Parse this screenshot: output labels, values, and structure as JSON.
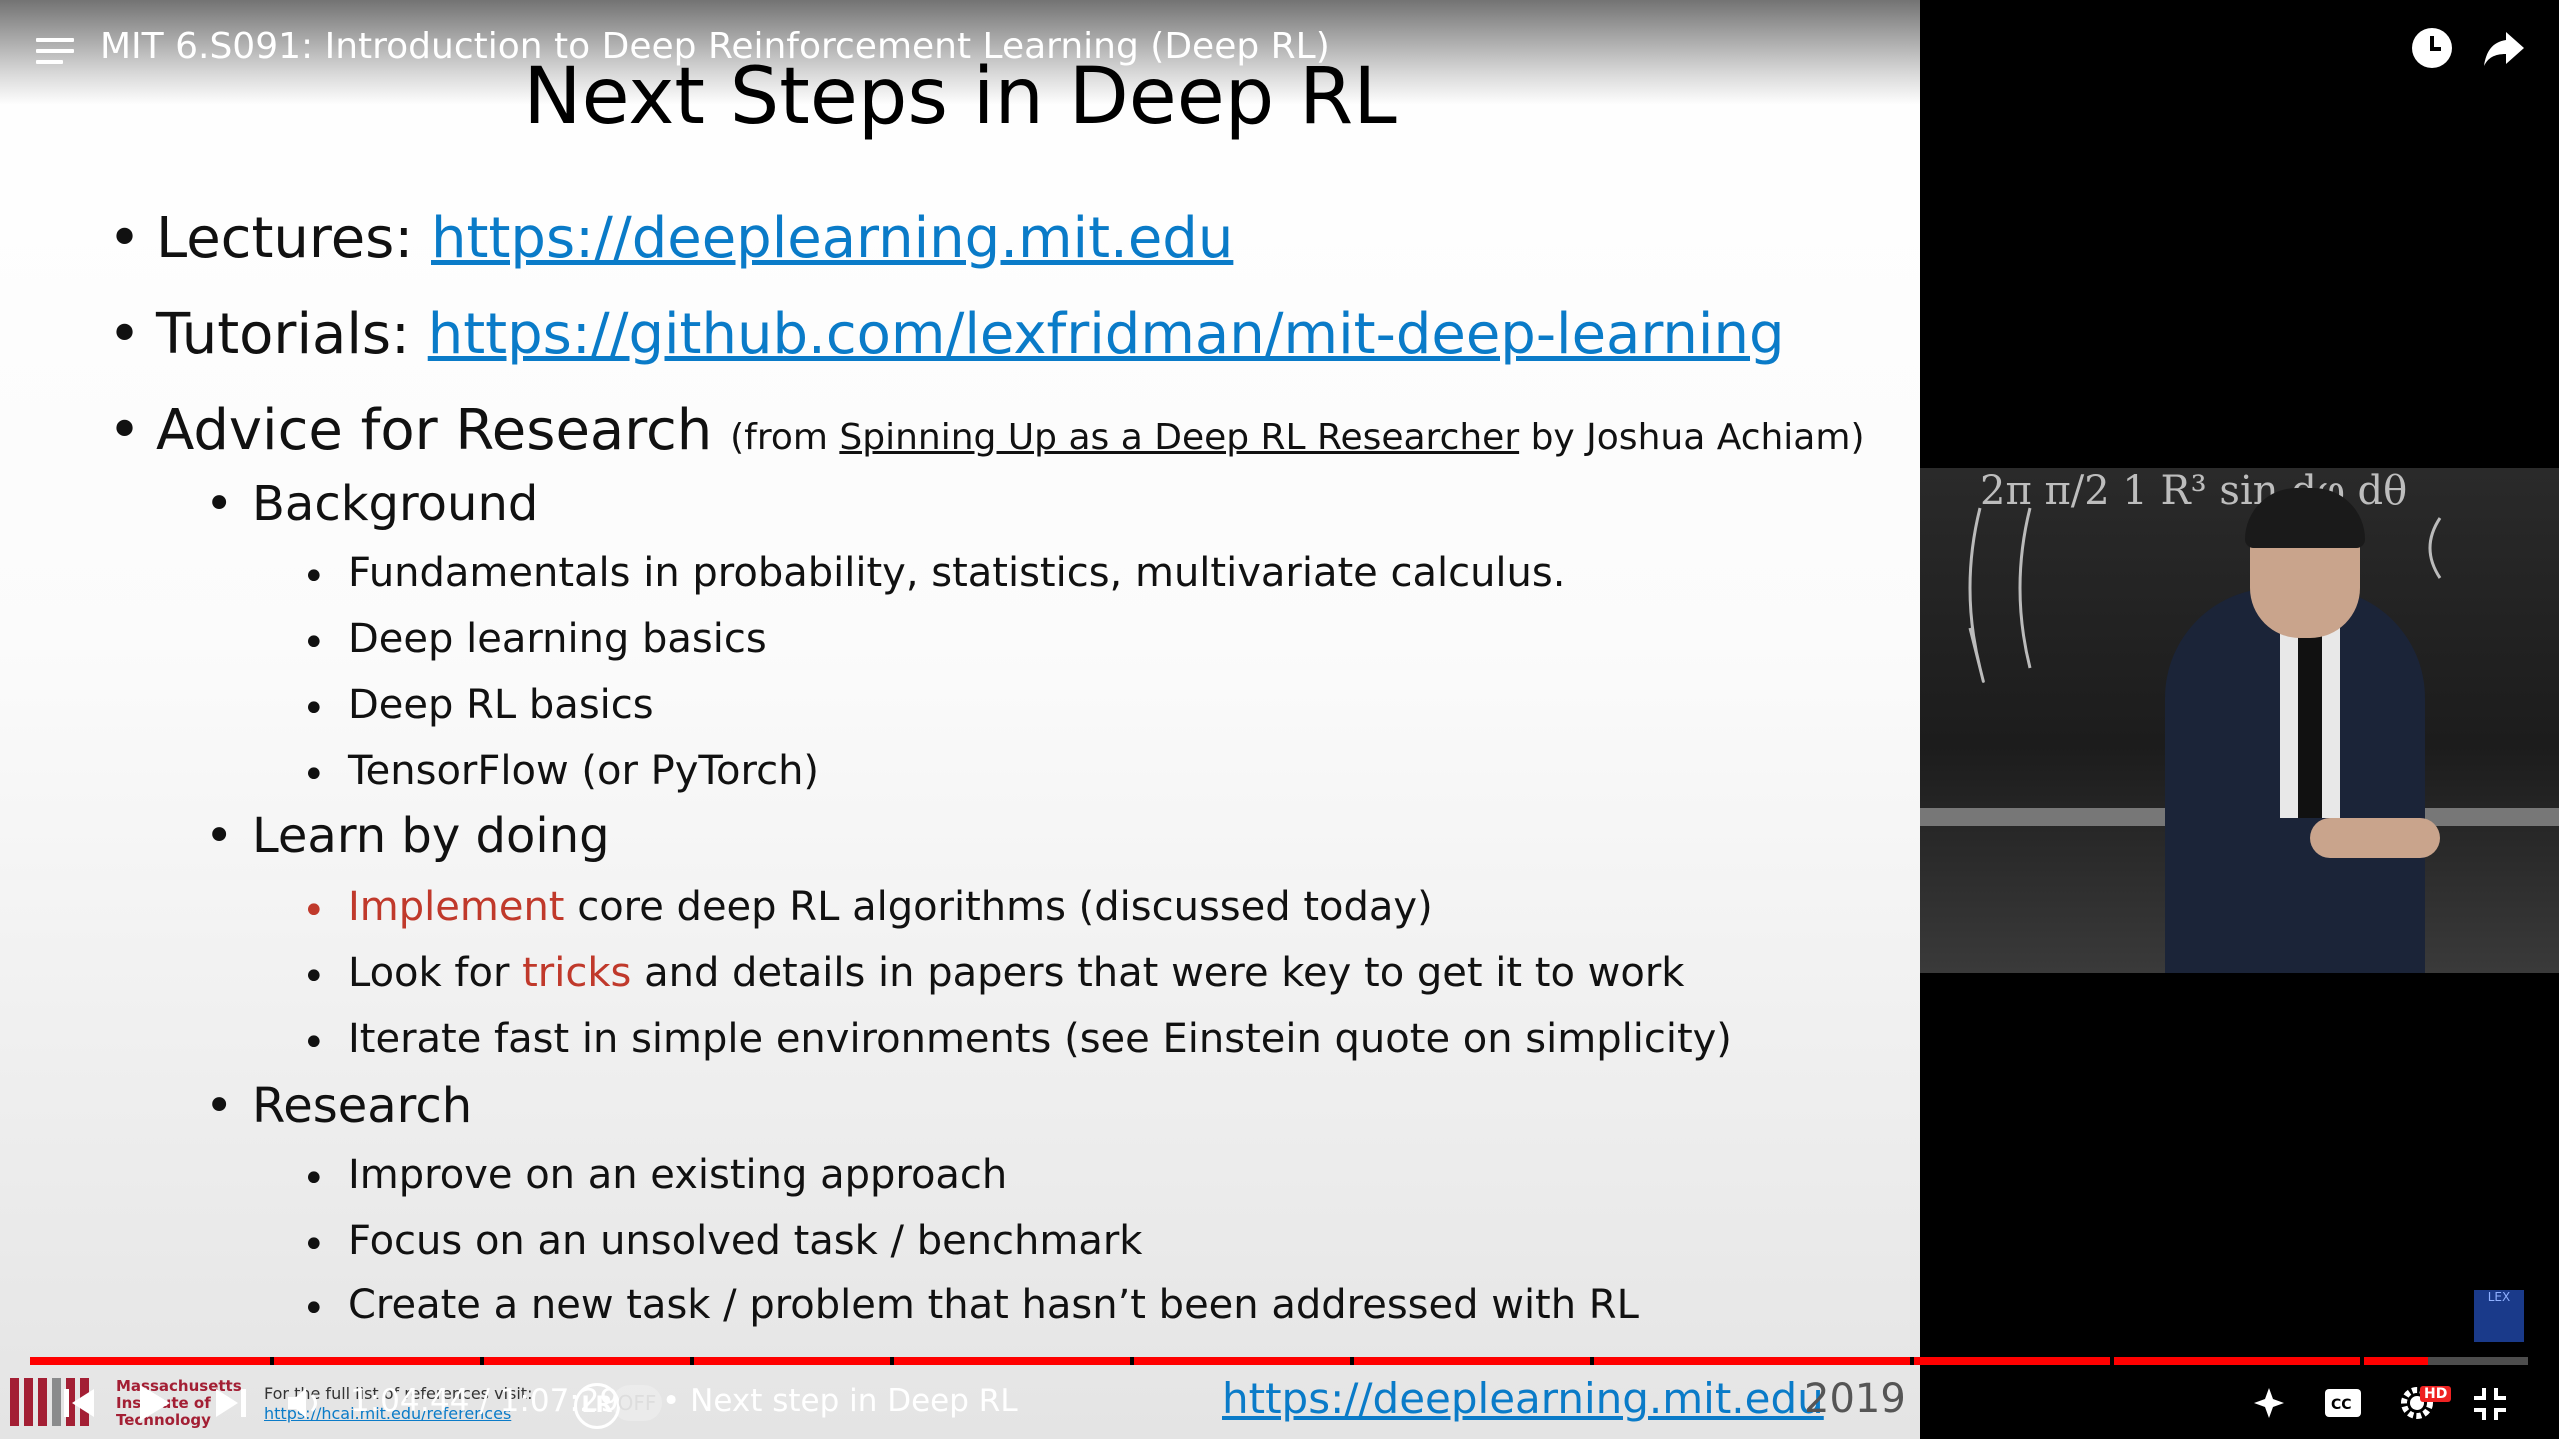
{
  "player": {
    "video_title": "MIT 6.S091: Introduction to Deep Reinforcement Learning (Deep RL)",
    "time_current": "1:04:44",
    "time_separator": " / ",
    "time_total": "1:07:29",
    "chapter": "• Next step in Deep RL",
    "progress_fraction": 0.96,
    "toggle_label": "OFF"
  },
  "slide": {
    "title": "Next Steps in Deep RL",
    "lectures_label": "Lectures: ",
    "lectures_url": "https://deeplearning.mit.edu",
    "tutorials_label": "Tutorials: ",
    "tutorials_url": "https://github.com/lexfridman/mit-deep-learning",
    "advice_label": "Advice for Research ",
    "advice_from": "(from ",
    "advice_source": "Spinning Up as a Deep RL Researcher",
    "advice_by": " by Joshua Achiam)",
    "background": {
      "label": "Background",
      "items": [
        "Fundamentals in probability, statistics, multivariate calculus.",
        "Deep learning basics",
        "Deep RL basics",
        "TensorFlow (or PyTorch)"
      ]
    },
    "learn": {
      "label": "Learn by doing",
      "item1_highlight": "Implement",
      "item1_rest": " core deep RL algorithms (discussed today)",
      "item2_pre": "Look for ",
      "item2_highlight": "tricks",
      "item2_rest": " and details in papers that were key to get it to work",
      "item3": "Iterate fast in simple environments (see Einstein quote on simplicity)"
    },
    "research": {
      "label": "Research",
      "items": [
        "Improve on an existing approach",
        "Focus on an unsolved task / benchmark",
        "Create a new task / problem that hasn’t been addressed with RL"
      ]
    },
    "footer": {
      "mit_text_1": "Massachusetts",
      "mit_text_2": "Institute of",
      "mit_text_3": "Technology",
      "ref_text": "For the full list of references visit:",
      "ref_url": "https://hcai.mit.edu/references",
      "link": "https://deeplearning.mit.edu",
      "year": "2019"
    }
  },
  "camera": {
    "board_text": "2π  π/2  1     R³ sin  dφ dθ",
    "lex_badge": "LEX"
  },
  "colors": {
    "link": "#0a7bc8",
    "highlight": "#c0392b",
    "progress": "#ff0000",
    "mit_red": "#a31f34"
  }
}
